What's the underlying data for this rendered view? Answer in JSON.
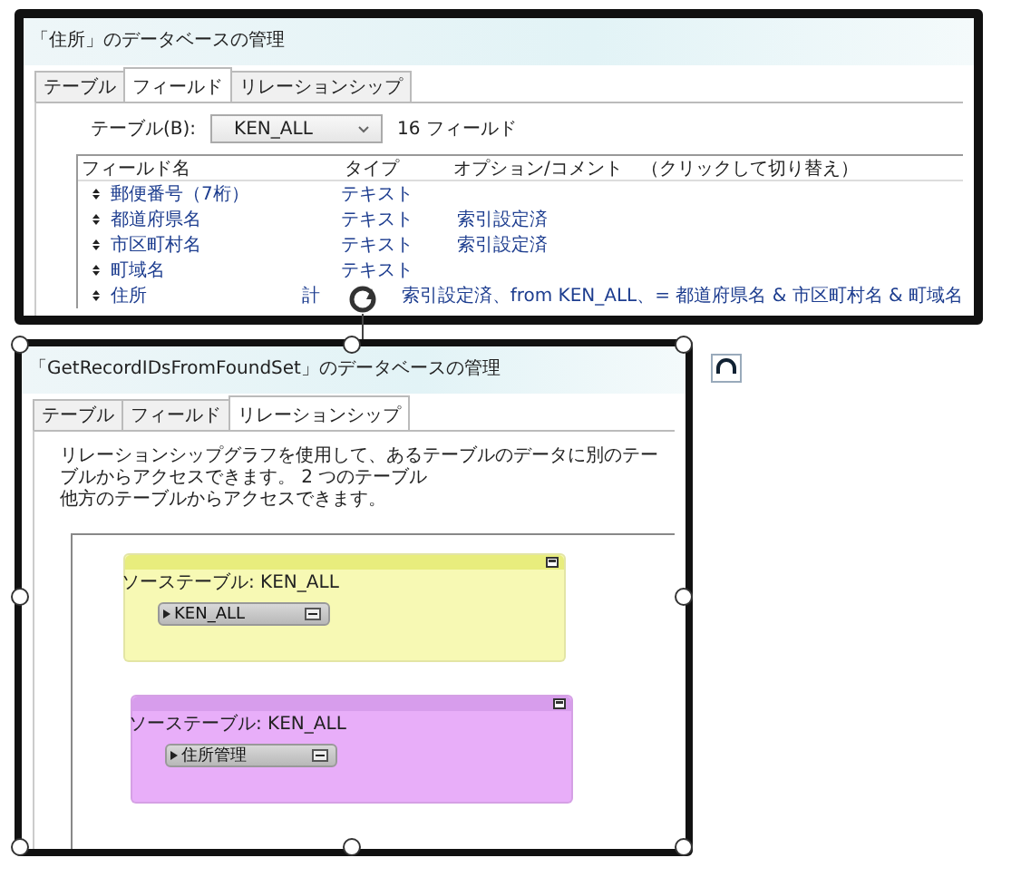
{
  "field_dialog": {
    "title": "「住所」のデータベースの管理",
    "tabs": [
      {
        "label": "テーブル",
        "selected": false
      },
      {
        "label": "フィールド",
        "selected": true
      },
      {
        "label": "リレーションシップ",
        "selected": false
      }
    ],
    "table_label": "テーブル(B):",
    "table_select": "KEN_ALL",
    "field_count": "16 フィールド",
    "columns": [
      "フィールド名",
      "タイプ",
      "オプション/コメント　（クリックして切り替え）"
    ],
    "rows": [
      {
        "name": "郵便番号（7桁）",
        "type": "テキスト",
        "options": ""
      },
      {
        "name": "都道府県名",
        "type": "テキスト",
        "options": "索引設定済"
      },
      {
        "name": "市区町村名",
        "type": "テキスト",
        "options": "索引設定済"
      },
      {
        "name": "町域名",
        "type": "テキスト",
        "options": ""
      },
      {
        "name": "住所",
        "type": "計",
        "options": "索引設定済、from KEN_ALL、= 都道府県名 & 市区町村名 & 町域名"
      }
    ]
  },
  "relationship_dialog": {
    "title": "「GetRecordIDsFromFoundSet」のデータベースの管理",
    "tabs": [
      {
        "label": "テーブル",
        "selected": false
      },
      {
        "label": "フィールド",
        "selected": false
      },
      {
        "label": "リレーションシップ",
        "selected": true
      }
    ],
    "description": [
      "リレーションシップグラフを使用して、あるテーブルのデータに別のテーブルからアクセスできます。 2 つのテーブル",
      "他方のテーブルからアクセスできます。"
    ],
    "table_occurrences": [
      {
        "title": "ソーステーブル: KEN_ALL",
        "table": "KEN_ALL",
        "color": "#f7f9b4"
      },
      {
        "title": "ソーステーブル: KEN_ALL",
        "table": "住所管理",
        "color": "#e8aef9"
      }
    ]
  }
}
